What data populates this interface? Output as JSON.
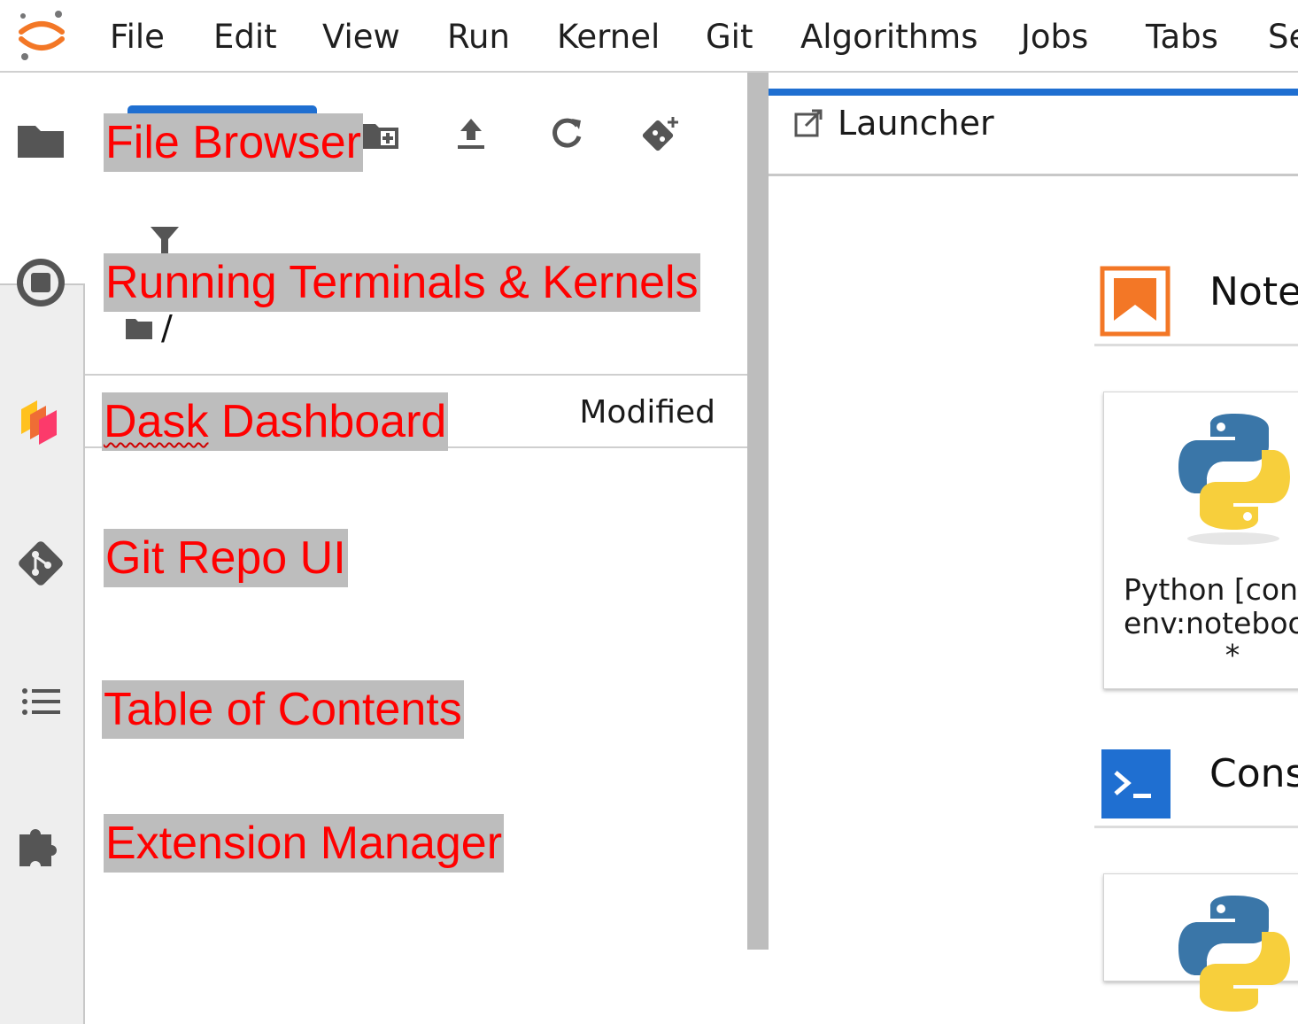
{
  "menubar": {
    "items": [
      "File",
      "Edit",
      "View",
      "Run",
      "Kernel",
      "Git",
      "Algorithms",
      "Jobs",
      "Tabs",
      "Se"
    ]
  },
  "file_browser": {
    "breadcrumb_root": "/",
    "column_modified": "Modified"
  },
  "main": {
    "tab_title": "Launcher",
    "sections": [
      {
        "title": "Note",
        "icon": "notebook-bookmark-icon"
      },
      {
        "title": "Cons",
        "icon": "console-prompt-icon"
      }
    ],
    "cards": [
      {
        "line1": "Python [con",
        "line2": "env:noteboo",
        "line3": "*"
      }
    ]
  },
  "annotations": {
    "file_browser": "File Browser",
    "running": "Running Terminals & Kernels",
    "dask_word": "Dask",
    "dask_rest": " Dashboard",
    "git": "Git Repo UI",
    "toc": "Table of Contents",
    "extensions": "Extension Manager"
  },
  "colors": {
    "accent_blue": "#1f6fd1",
    "annotation_text": "#ff0000",
    "annotation_bg": "#bdbdbd",
    "notebook_orange": "#f37726",
    "console_blue": "#1f6fd1"
  }
}
